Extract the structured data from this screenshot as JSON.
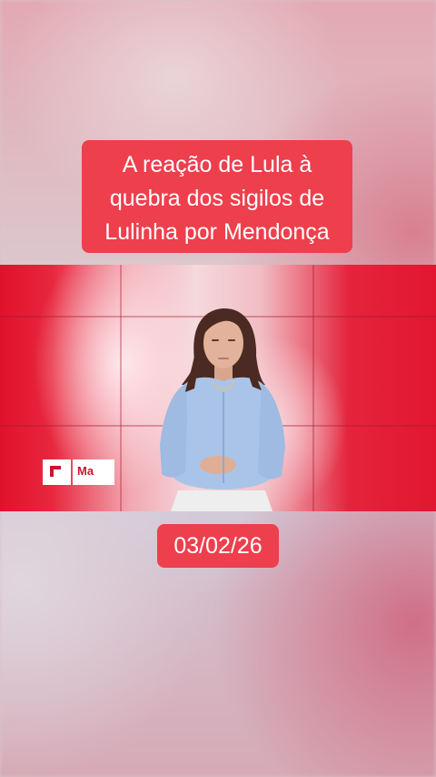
{
  "headline": {
    "line1": "A reação de Lula à",
    "line2": "quebra dos sigilos de",
    "line3": "Lulinha por Mendonça"
  },
  "video": {
    "logo_text": "Ma"
  },
  "date_label": "03/02/26",
  "colors": {
    "accent_red": "#ee3f4d",
    "studio_red": "#e2162f",
    "shirt_blue": "#a9c4e8",
    "logo_red": "#c5172e"
  }
}
